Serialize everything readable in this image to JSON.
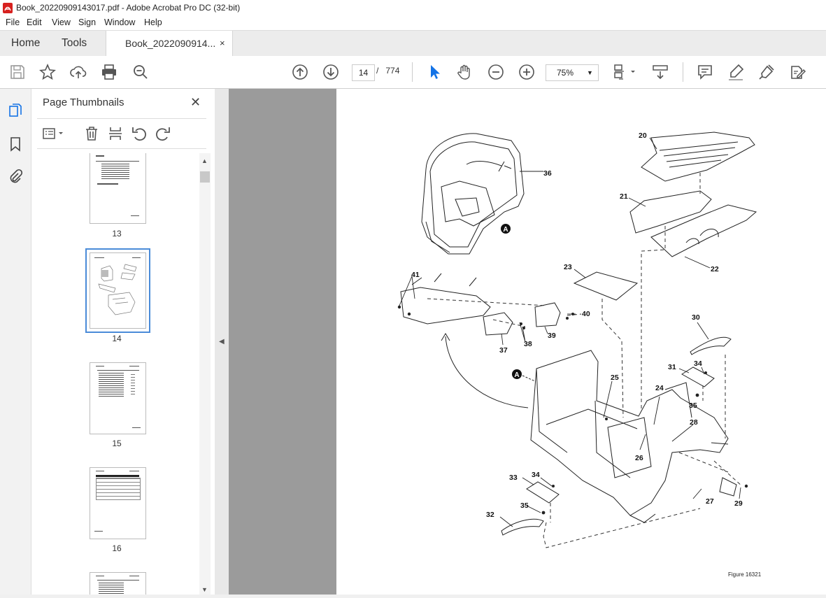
{
  "window": {
    "title": "Book_20220909143017.pdf - Adobe Acrobat Pro DC (32-bit)"
  },
  "menu": [
    "File",
    "Edit",
    "View",
    "Sign",
    "Window",
    "Help"
  ],
  "tabs": {
    "home": "Home",
    "tools": "Tools",
    "document": "Book_2022090914...",
    "close": "×"
  },
  "toolbar": {
    "current_page": "14",
    "page_separator": "/",
    "total_pages": "774",
    "zoom": "75%"
  },
  "sidebar": {
    "title": "Page Thumbnails",
    "close": "✕",
    "thumbnails": [
      {
        "page": "13",
        "selected": false
      },
      {
        "page": "14",
        "selected": true
      },
      {
        "page": "15",
        "selected": false
      },
      {
        "page": "16",
        "selected": false
      }
    ]
  },
  "figure": {
    "callouts": [
      "20",
      "21",
      "22",
      "23",
      "24",
      "25",
      "26",
      "27",
      "28",
      "29",
      "30",
      "31",
      "32",
      "33",
      "34",
      "34",
      "35",
      "35",
      "36",
      "37",
      "38",
      "39",
      "40",
      "41"
    ],
    "detail_marker": "A",
    "caption": "Figure 16321"
  },
  "colors": {
    "accent": "#1473e6",
    "panel_bg": "#9b9b9b"
  }
}
